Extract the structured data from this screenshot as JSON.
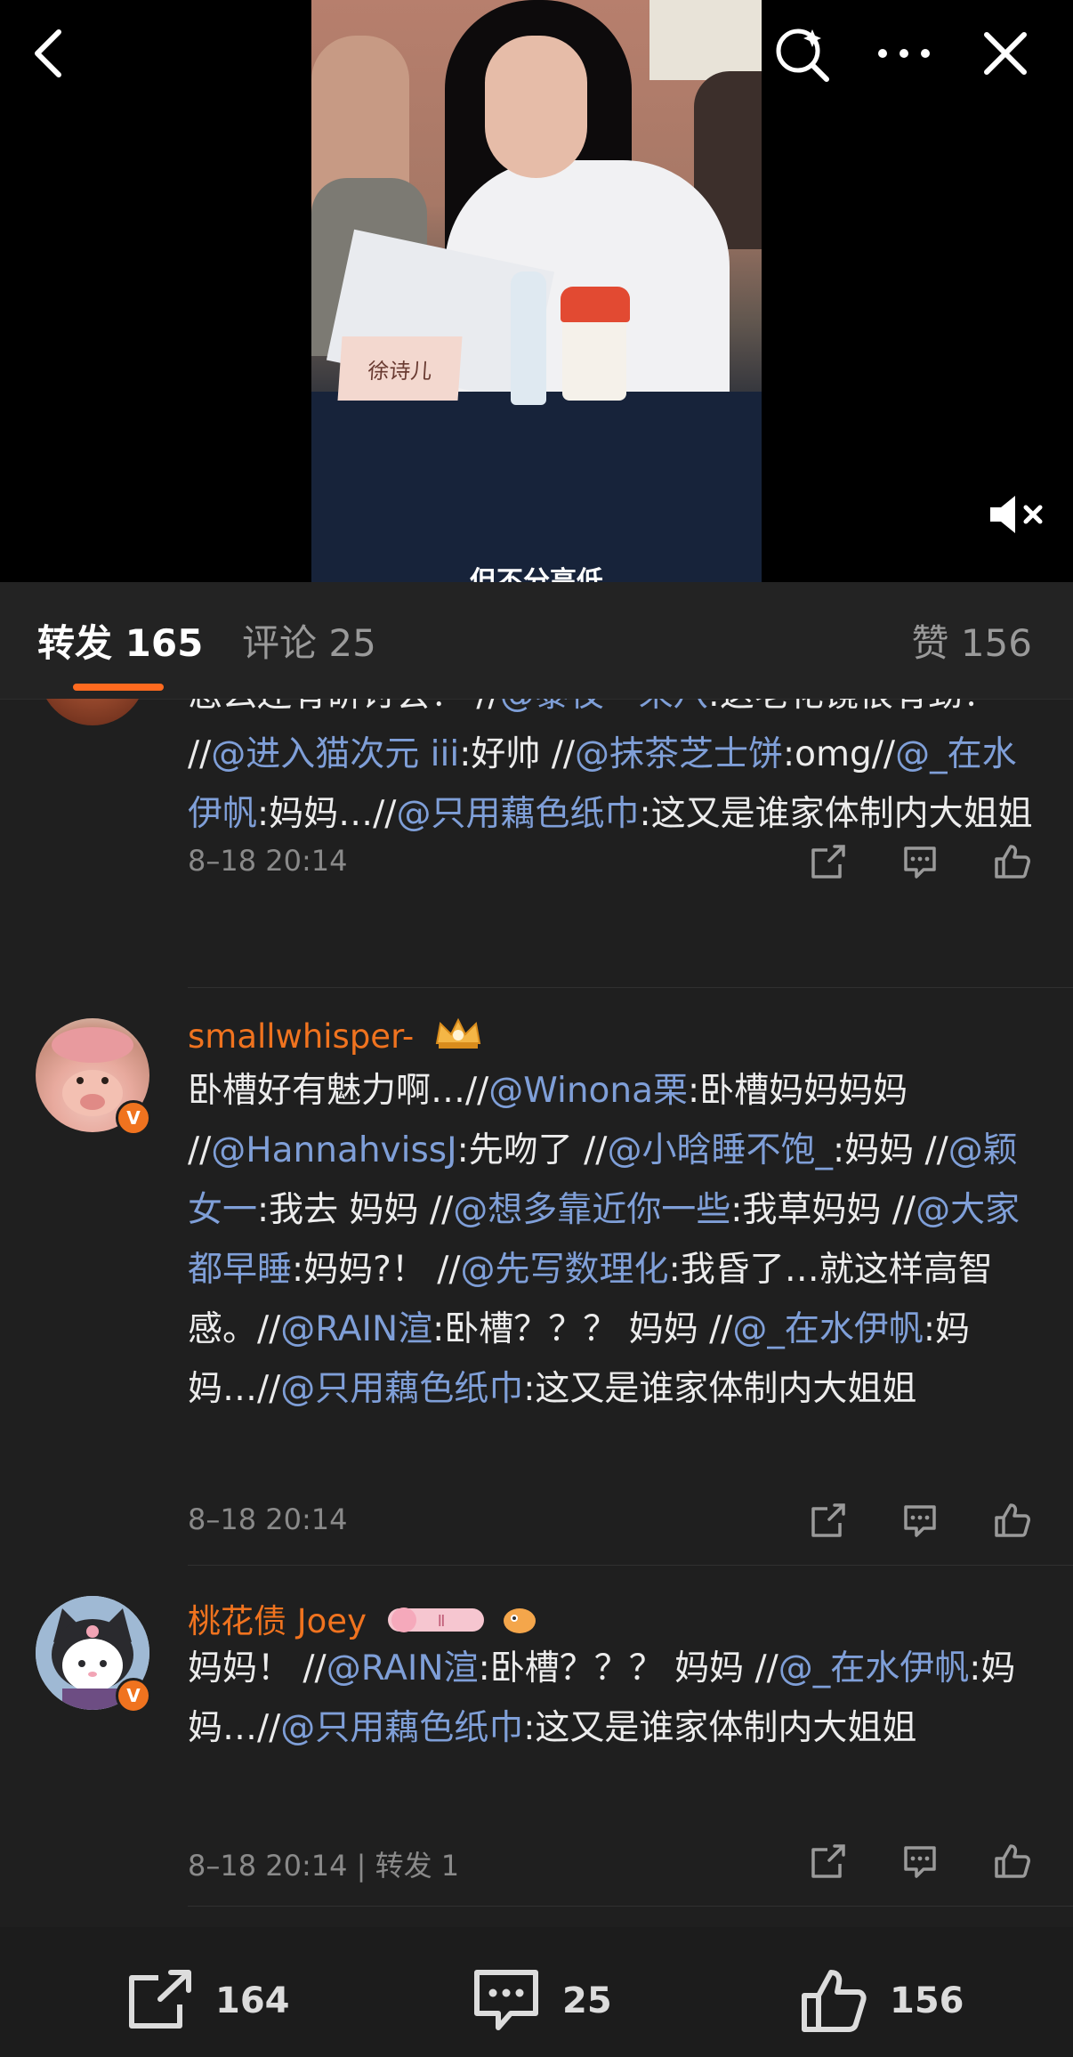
{
  "video": {
    "nameplate": "徐诗儿",
    "subtitle": "但不分高低"
  },
  "tabs": {
    "repost_label": "转发",
    "repost_count": "165",
    "comment_label": "评论",
    "comment_count": "25",
    "like_label": "赞",
    "like_count": "156"
  },
  "comments": [
    {
      "segments": [
        {
          "t": "怎么还有研讨会？ //",
          "m": false
        },
        {
          "t": "@黎夜一来八",
          "m": true
        },
        {
          "t": ":这老花镜很有劲！ //",
          "m": false
        },
        {
          "t": "@进入猫次元 iii",
          "m": true
        },
        {
          "t": ":好帅 //",
          "m": false
        },
        {
          "t": "@抹茶芝士饼",
          "m": true
        },
        {
          "t": ":omg//",
          "m": false
        },
        {
          "t": "@_在水伊帆",
          "m": true
        },
        {
          "t": ":妈妈…//",
          "m": false
        },
        {
          "t": "@只用藕色纸巾",
          "m": true
        },
        {
          "t": ":这又是谁家体制内大姐姐",
          "m": false
        }
      ],
      "meta": "8–18 20:14"
    },
    {
      "username": "smallwhisper-",
      "segments": [
        {
          "t": "卧槽好有魅力啊…//",
          "m": false
        },
        {
          "t": "@Winona栗",
          "m": true
        },
        {
          "t": ":卧槽妈妈妈妈 //",
          "m": false
        },
        {
          "t": "@HannahvissJ",
          "m": true
        },
        {
          "t": ":先吻了 //",
          "m": false
        },
        {
          "t": "@小晗睡不饱_",
          "m": true
        },
        {
          "t": ":妈妈 //",
          "m": false
        },
        {
          "t": "@颖女一",
          "m": true
        },
        {
          "t": ":我去 妈妈 //",
          "m": false
        },
        {
          "t": "@想多靠近你一些",
          "m": true
        },
        {
          "t": ":我草妈妈 //",
          "m": false
        },
        {
          "t": "@大家都早睡",
          "m": true
        },
        {
          "t": ":妈妈?！ //",
          "m": false
        },
        {
          "t": "@先写数理化",
          "m": true
        },
        {
          "t": ":我昏了…就这样高智感。//",
          "m": false
        },
        {
          "t": "@RAIN渲",
          "m": true
        },
        {
          "t": ":卧槽？？？ 妈妈 //",
          "m": false
        },
        {
          "t": "@_在水伊帆",
          "m": true
        },
        {
          "t": ":妈妈…//",
          "m": false
        },
        {
          "t": "@只用藕色纸巾",
          "m": true
        },
        {
          "t": ":这又是谁家体制内大姐姐",
          "m": false
        }
      ],
      "meta": "8–18 20:14"
    },
    {
      "username": "桃花债 Joey",
      "segments": [
        {
          "t": "妈妈！ //",
          "m": false
        },
        {
          "t": "@RAIN渲",
          "m": true
        },
        {
          "t": ":卧槽？？？ 妈妈 //",
          "m": false
        },
        {
          "t": "@_在水伊帆",
          "m": true
        },
        {
          "t": ":妈妈…//",
          "m": false
        },
        {
          "t": "@只用藕色纸巾",
          "m": true
        },
        {
          "t": ":这又是谁家体制内大姐姐",
          "m": false
        }
      ],
      "meta": "8–18 20:14 | 转发 1"
    }
  ],
  "bottom": {
    "repost_count": "164",
    "comment_count": "25",
    "like_count": "156"
  },
  "colors": {
    "accent": "#f0731f",
    "mention": "#7f9fd8",
    "tab_indicator": "#ff6a1f"
  }
}
